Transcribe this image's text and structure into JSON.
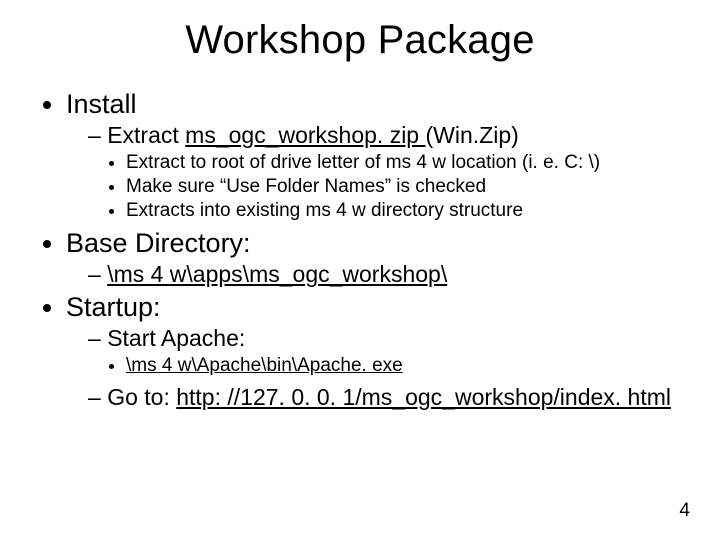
{
  "title": "Workshop Package",
  "bullets": {
    "install": {
      "label": "Install",
      "extract": {
        "prefix": "Extract ",
        "file": "ms_ogc_workshop. zip ",
        "suffix": "(Win.Zip)",
        "sub": {
          "a": "Extract to root of drive letter of ms 4 w location (i. e. C: \\)",
          "b": "Make sure “Use Folder Names” is checked",
          "c": "Extracts into existing ms 4 w directory structure"
        }
      }
    },
    "basedir": {
      "label": "Base Directory:",
      "path": "\\ms 4 w\\apps\\ms_ogc_workshop\\"
    },
    "startup": {
      "label": "Startup:",
      "startapache": {
        "label": "Start Apache:",
        "exe": "\\ms 4 w\\Apache\\bin\\Apache. exe"
      },
      "goto": {
        "prefix": "Go to: ",
        "url": "http: //127. 0. 0. 1/ms_ogc_workshop/index. html"
      }
    }
  },
  "page_number": "4"
}
